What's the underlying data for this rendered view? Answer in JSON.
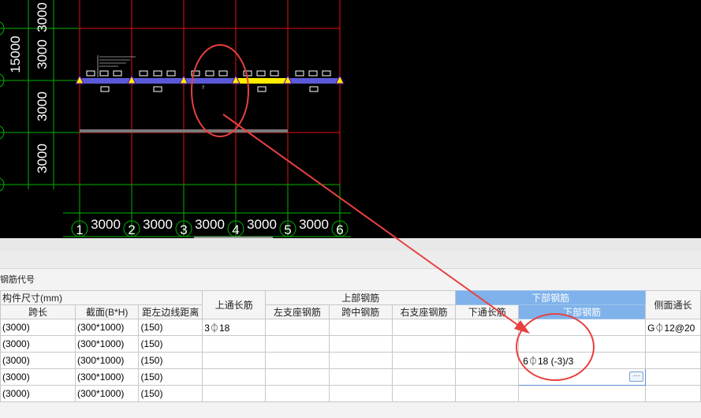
{
  "drawing": {
    "left_dims": [
      "3000",
      "3000",
      "3000",
      "3000"
    ],
    "overall_dim": "15000",
    "bottom_dims": [
      "3000",
      "3000",
      "3000",
      "3000",
      "3000"
    ],
    "axis_labels": [
      "1",
      "2",
      "3",
      "4",
      "5",
      "6"
    ],
    "small_note": "?"
  },
  "panel": {
    "section_title": "钢筋代号"
  },
  "table": {
    "group_headers": {
      "size": "构件尺寸(mm)",
      "top_bars": "上部钢筋",
      "bottom_bars": "下部钢筋"
    },
    "headers": {
      "span_length": "跨长",
      "section": "截面(B*H)",
      "offset": "距左边线距离",
      "top_through": "上通长筋",
      "left_support": "左支座钢筋",
      "mid_span": "跨中钢筋",
      "right_support": "右支座钢筋",
      "bottom_through": "下通长筋",
      "bottom_bar": "下部钢筋",
      "side_through": "侧面通长"
    },
    "rows": [
      {
        "span": "(3000)",
        "section": "(300*1000)",
        "offset": "(150)",
        "top_through": "3⏀18",
        "left": "",
        "mid": "",
        "right": "",
        "bottom_through": "",
        "bottom": "",
        "side": "G⏀12@20"
      },
      {
        "span": "(3000)",
        "section": "(300*1000)",
        "offset": "(150)",
        "top_through": "",
        "left": "",
        "mid": "",
        "right": "",
        "bottom_through": "",
        "bottom": "",
        "side": ""
      },
      {
        "span": "(3000)",
        "section": "(300*1000)",
        "offset": "(150)",
        "top_through": "",
        "left": "",
        "mid": "",
        "right": "",
        "bottom_through": "",
        "bottom": "6⏀18 (-3)/3",
        "side": ""
      },
      {
        "span": "(3000)",
        "section": "(300*1000)",
        "offset": "(150)",
        "top_through": "",
        "left": "",
        "mid": "",
        "right": "",
        "bottom_through": "",
        "bottom": "",
        "side": ""
      },
      {
        "span": "(3000)",
        "section": "(300*1000)",
        "offset": "(150)",
        "top_through": "",
        "left": "",
        "mid": "",
        "right": "",
        "bottom_through": "",
        "bottom": "",
        "side": ""
      }
    ],
    "ellipsis": "···"
  },
  "colors": {
    "grid_green": "#00b400",
    "grid_red": "#e01010",
    "beam_blue": "#5a5ad8",
    "support_yellow": "#ffee00",
    "annotation_red": "#e84040"
  }
}
